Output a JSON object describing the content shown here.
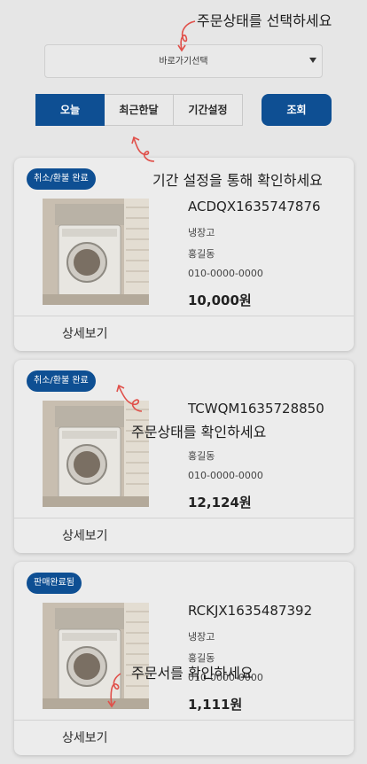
{
  "filter": {
    "status_select": "바로가기선택",
    "tabs": [
      {
        "label": "오늘",
        "active": true
      },
      {
        "label": "최근한달",
        "active": false
      },
      {
        "label": "기간설정",
        "active": false
      }
    ],
    "search_button": "조회"
  },
  "orders": [
    {
      "status": "취소/환불 완료",
      "order_no": "ACDQX1635747876",
      "product": "냉장고",
      "name": "홍길동",
      "phone": "010-0000-0000",
      "price": "10,000원",
      "detail_label": "상세보기"
    },
    {
      "status": "취소/환불 완료",
      "order_no": "TCWQM1635728850",
      "product": "",
      "name": "홍길동",
      "phone": "010-0000-0000",
      "price": "12,124원",
      "detail_label": "상세보기"
    },
    {
      "status": "판매완료됨",
      "order_no": "RCKJX1635487392",
      "product": "냉장고",
      "name": "홍길동",
      "phone": "010-0000-0000",
      "price": "1,111원",
      "detail_label": "상세보기"
    }
  ],
  "annotations": {
    "select_status": "주문상태를 선택하세요",
    "period": "기간 설정을 통해 확인하세요",
    "status_check": "주문상태를 확인하세요",
    "order_check": "주문서를 확인하세요"
  },
  "colors": {
    "primary": "#0e4f93",
    "arrow": "#e0504a",
    "overlay": "#e6e6e6"
  },
  "icons": {
    "select_arrow": "chevron-down-icon",
    "annotation_arrow": "hand-drawn-arrow-icon"
  }
}
